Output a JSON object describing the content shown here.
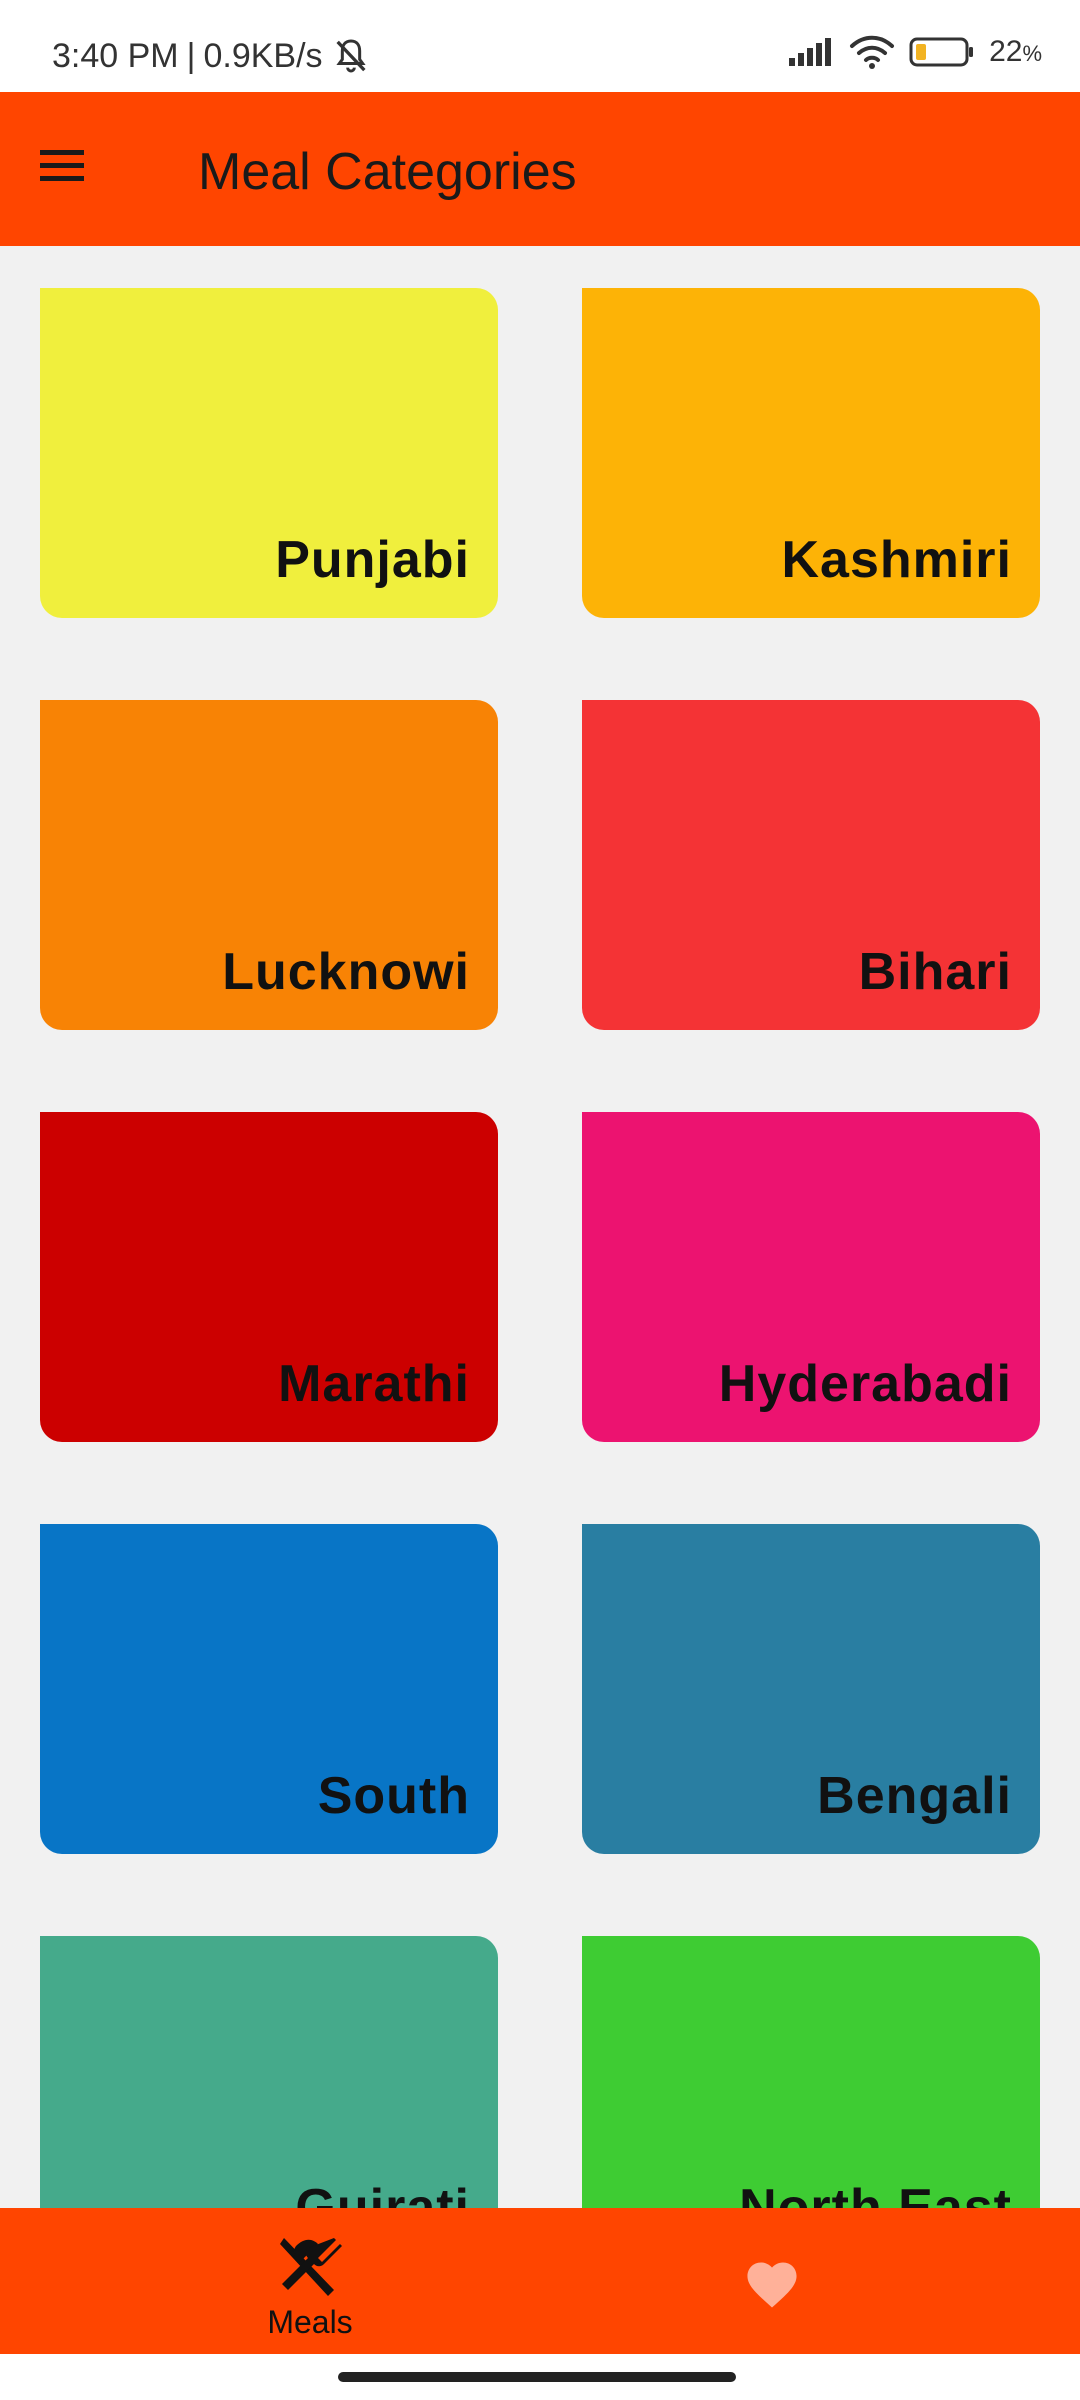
{
  "status_bar": {
    "time": "3:40 PM",
    "network_speed": "0.9KB/s",
    "battery_percent": "22",
    "battery_unit": "%",
    "icons": [
      "notifications-muted-icon",
      "signal-icon",
      "wifi-icon",
      "battery-icon"
    ]
  },
  "app_bar": {
    "title": "Meal Categories",
    "menu_icon": "hamburger-menu-icon"
  },
  "categories": [
    {
      "label": "Punjabi",
      "color": "#f0ef3d"
    },
    {
      "label": "Kashmiri",
      "color": "#fdb306"
    },
    {
      "label": "Lucknowi",
      "color": "#f88305"
    },
    {
      "label": "Bihari",
      "color": "#f43335"
    },
    {
      "label": "Marathi",
      "color": "#cc0000"
    },
    {
      "label": "Hyderabadi",
      "color": "#ec1370"
    },
    {
      "label": "South",
      "color": "#0875c6"
    },
    {
      "label": "Bengali",
      "color": "#297ea2"
    },
    {
      "label": "Gujrati",
      "color": "#45aa8b"
    },
    {
      "label": "North East",
      "color": "#3ecc33"
    }
  ],
  "bottom_nav": {
    "items": [
      {
        "label": "Meals",
        "icon": "fork-knife-icon",
        "active": true
      },
      {
        "label": "",
        "icon": "heart-icon",
        "active": false
      }
    ]
  },
  "theme": {
    "primary": "#ff4500",
    "heart_color": "#ffb199"
  }
}
